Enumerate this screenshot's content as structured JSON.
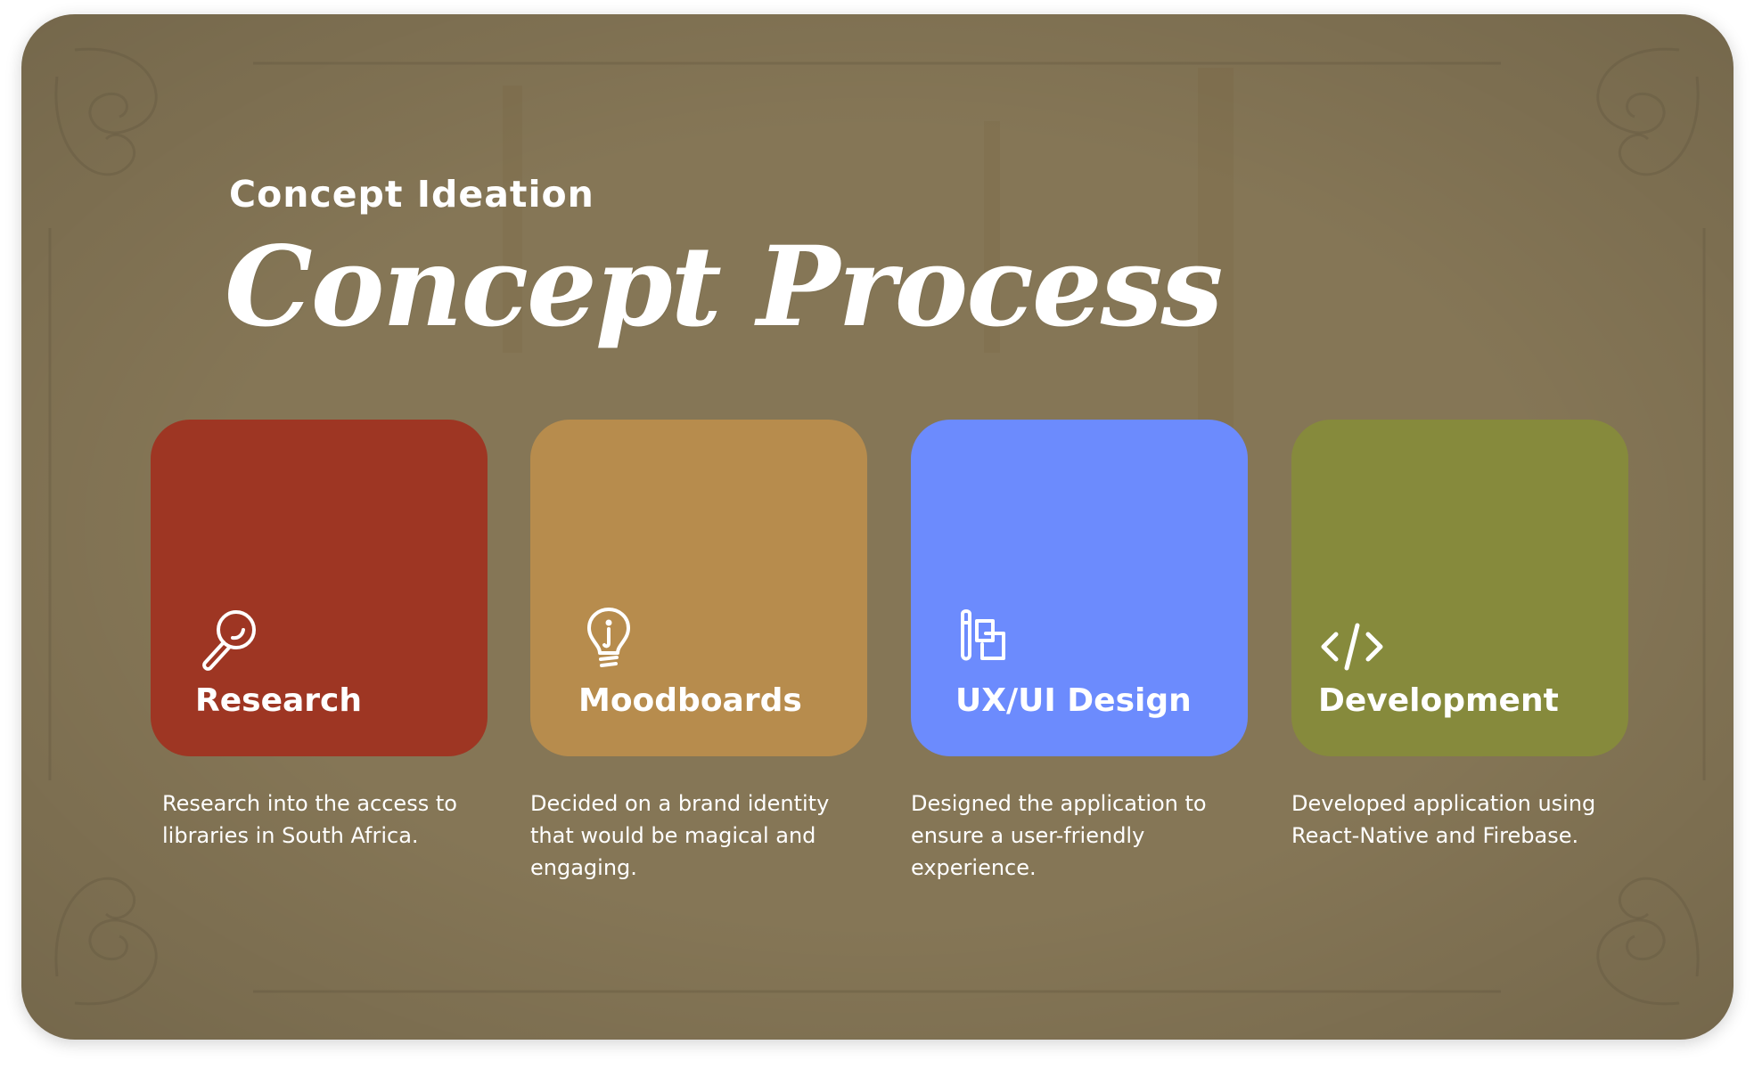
{
  "eyebrow": "Concept Ideation",
  "headline": "Concept Process",
  "colors": {
    "background": "#857656",
    "research": "#9E3623",
    "moodboards": "#B78C4D",
    "uxui": "#6C8BFD",
    "development": "#868A3C"
  },
  "cards": [
    {
      "title": "Research",
      "icon": "magnifying-glass-icon",
      "description": "Research into the access to libraries in South Africa."
    },
    {
      "title": "Moodboards",
      "icon": "lightbulb-icon",
      "description": "Decided on a brand identity that would be magical and engaging."
    },
    {
      "title": "UX/UI Design",
      "icon": "design-tools-icon",
      "description": "Designed the application to ensure a user-friendly experience."
    },
    {
      "title": "Development",
      "icon": "code-icon",
      "description": "Developed application using React-Native and Firebase."
    }
  ]
}
